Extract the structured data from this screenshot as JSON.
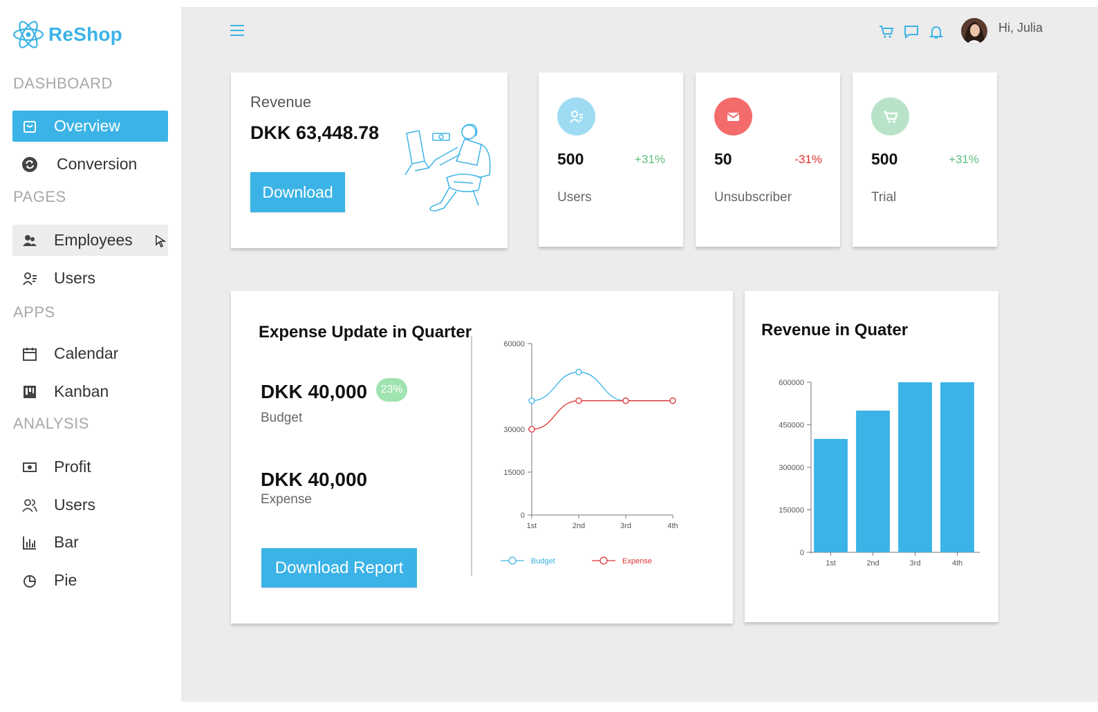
{
  "app": {
    "name": "ReShop"
  },
  "sidebar": {
    "sections": {
      "dashboard": "DASHBOARD",
      "pages": "PAGES",
      "apps": "APPS",
      "analysis": "ANALYSIS"
    },
    "items": {
      "overview": "Overview",
      "conversion": "Conversion",
      "employees": "Employees",
      "users": "Users",
      "calendar": "Calendar",
      "kanban": "Kanban",
      "profit": "Profit",
      "analysis_users": "Users",
      "bar": "Bar",
      "pie": "Pie"
    }
  },
  "header": {
    "greeting": "Hi, Julia"
  },
  "revenue": {
    "title": "Revenue",
    "value": "DKK 63,448.78",
    "button": "Download"
  },
  "stats": [
    {
      "value": "500",
      "change": "+31%",
      "label": "Users",
      "icon": "users-icon",
      "color": "#9fdcf3",
      "change_color": "#5cbf7a"
    },
    {
      "value": "50",
      "change": "-31%",
      "label": "Unsubscriber",
      "icon": "mail-icon",
      "color": "#f36b6b",
      "change_color": "#e03232"
    },
    {
      "value": "500",
      "change": "+31%",
      "label": "Trial",
      "icon": "cart-icon",
      "color": "#b9e3c8",
      "change_color": "#5cbf7a"
    }
  ],
  "expense": {
    "title": "Expense Update in Quarter",
    "budget_value": "DKK 40,000",
    "badge": "23%",
    "budget_label": "Budget",
    "expense_value": "DKK 40,000",
    "expense_label": "Expense",
    "button": "Download Report"
  },
  "bar_section": {
    "title": "Revenue in Quater"
  },
  "colors": {
    "accent": "#3bb3e6",
    "budget": "#3bb3e6",
    "expense": "#e03232"
  },
  "chart_data": [
    {
      "type": "line",
      "categories": [
        "1st",
        "2nd",
        "3rd",
        "4th"
      ],
      "series": [
        {
          "name": "Budget",
          "values": [
            40000,
            50000,
            40000,
            40000
          ],
          "color": "#3bb3e6"
        },
        {
          "name": "Expense",
          "values": [
            30000,
            40000,
            40000,
            40000
          ],
          "color": "#e03232"
        }
      ],
      "ylim": [
        0,
        60000
      ],
      "yticks": [
        "0",
        "15000",
        "30000",
        "60000"
      ],
      "legend": "bottom"
    },
    {
      "type": "bar",
      "categories": [
        "1st",
        "2nd",
        "3rd",
        "4th"
      ],
      "values": [
        400000,
        500000,
        600000,
        600000
      ],
      "ylim": [
        0,
        600000
      ],
      "yticks": [
        "0",
        "150000",
        "300000",
        "450000",
        "600000"
      ],
      "color": "#3bb3e6"
    }
  ]
}
